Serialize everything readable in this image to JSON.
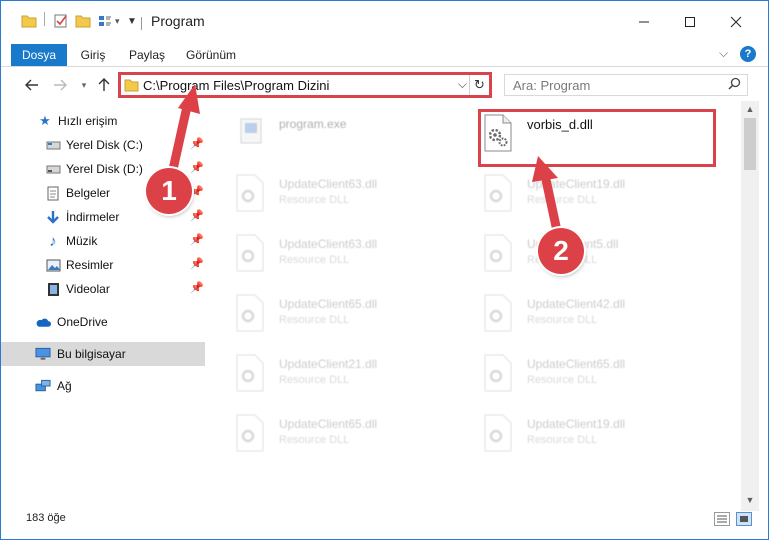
{
  "window": {
    "title": "Program"
  },
  "ribbon": {
    "tabs": [
      {
        "label": "Dosya",
        "active": true
      },
      {
        "label": "Giriş",
        "active": false
      },
      {
        "label": "Paylaş",
        "active": false
      },
      {
        "label": "Görünüm",
        "active": false
      }
    ]
  },
  "address": {
    "path": "C:\\Program Files\\Program Dizini"
  },
  "search": {
    "placeholder": "Ara: Program"
  },
  "sidebar": {
    "items": [
      {
        "label": "Hızlı erişim",
        "icon": "star-icon"
      },
      {
        "label": "Yerel Disk (C:)",
        "icon": "drive-icon"
      },
      {
        "label": "Yerel Disk (D:)",
        "icon": "drive-icon"
      },
      {
        "label": "Belgeler",
        "icon": "documents-icon"
      },
      {
        "label": "İndirmeler",
        "icon": "download-icon"
      },
      {
        "label": "Müzik",
        "icon": "music-icon"
      },
      {
        "label": "Resimler",
        "icon": "pictures-icon"
      },
      {
        "label": "Videolar",
        "icon": "video-icon"
      },
      {
        "label": "OneDrive",
        "icon": "cloud-icon"
      },
      {
        "label": "Bu bilgisayar",
        "icon": "computer-icon"
      },
      {
        "label": "Ağ",
        "icon": "network-icon"
      }
    ]
  },
  "files": [
    {
      "name": "program.exe",
      "type": ""
    },
    {
      "name": "vorbis_d.dll",
      "type": ""
    },
    {
      "name": "UpdateClient63.dll",
      "type": "Resource DLL"
    },
    {
      "name": "UpdateClient19.dll",
      "type": "Resource DLL"
    },
    {
      "name": "UpdateClient63.dll",
      "type": "Resource DLL"
    },
    {
      "name": "UpdateClient5.dll",
      "type": "Resource DLL"
    },
    {
      "name": "UpdateClient65.dll",
      "type": "Resource DLL"
    },
    {
      "name": "UpdateClient42.dll",
      "type": "Resource DLL"
    },
    {
      "name": "UpdateClient21.dll",
      "type": "Resource DLL"
    },
    {
      "name": "UpdateClient65.dll",
      "type": "Resource DLL"
    },
    {
      "name": "UpdateClient65.dll",
      "type": "Resource DLL"
    },
    {
      "name": "UpdateClient19.dll",
      "type": "Resource DLL"
    }
  ],
  "status": {
    "count": "183 öğe"
  },
  "markers": {
    "one": "1",
    "two": "2"
  },
  "colors": {
    "accent": "#1979ca",
    "annotation": "#dd4148"
  }
}
